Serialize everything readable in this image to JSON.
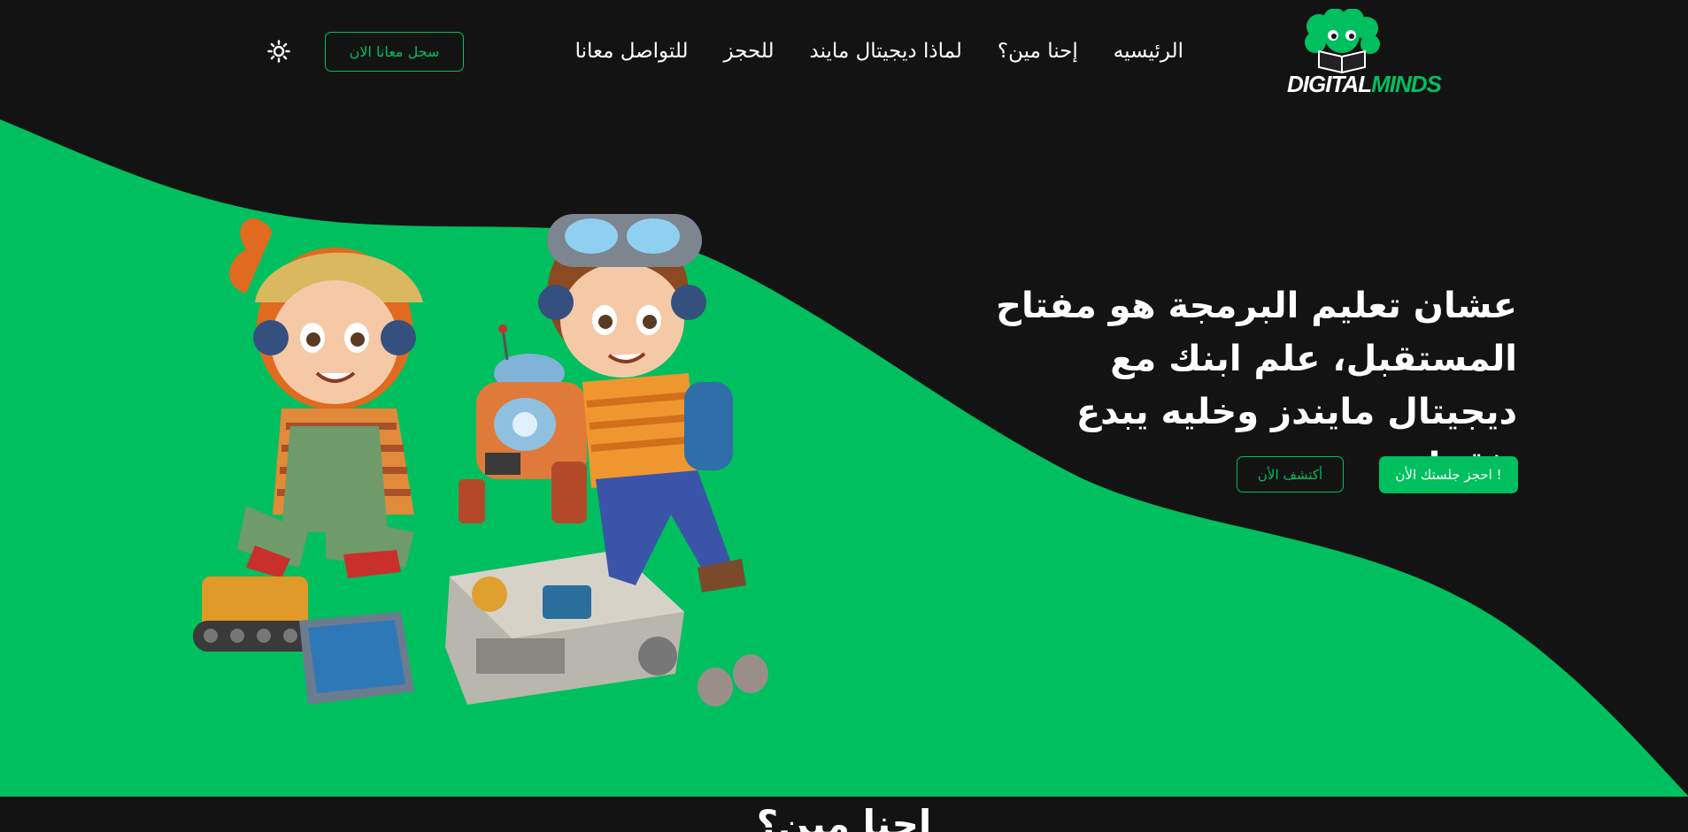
{
  "brand": {
    "logo_part1": "DIGITAL",
    "logo_part2": "MINDS",
    "accent_color": "#00bf5f",
    "background_color": "#131313"
  },
  "nav": {
    "items": [
      {
        "label": "الرئيسيه"
      },
      {
        "label": "إحنا مين؟"
      },
      {
        "label": "لماذا ديجيتال مايند"
      },
      {
        "label": "للحجز"
      },
      {
        "label": "للتواصل معانا"
      }
    ],
    "register_label": "سجل معانا الان",
    "theme_icon": "sun-icon"
  },
  "hero": {
    "title": "عشان تعليم البرمجة هو مفتاح المستقبل، علم ابنك مع ديجيتال مايندز وخليه يبدع بثقة!",
    "primary_cta": "احجز جلستك الأن !",
    "secondary_cta": "أكتشف الأن",
    "illustration": "kids-robot-illustration"
  },
  "next_section": {
    "title": "إحنا مين؟"
  }
}
